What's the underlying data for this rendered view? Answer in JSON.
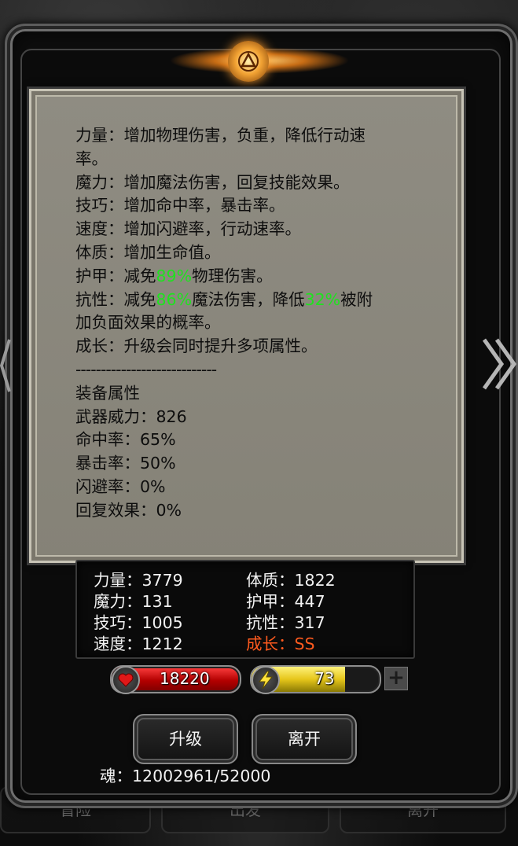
{
  "info_panel": {
    "lines": [
      {
        "id": "l1",
        "text": "力量：增加物理伤害，负重，降低行动速"
      },
      {
        "id": "l2",
        "text": "率。"
      },
      {
        "id": "l3",
        "text": "魔力：增加魔法伤害，回复技能效果。"
      },
      {
        "id": "l4",
        "text": "技巧：增加命中率，暴击率。"
      },
      {
        "id": "l5",
        "text": "速度：增加闪避率，行动速率。"
      },
      {
        "id": "l6",
        "text": "体质：增加生命值。"
      }
    ],
    "armor_line": {
      "prefix": "护甲：减免",
      "value": "89%",
      "suffix": "物理伤害。"
    },
    "resist_line": {
      "prefix": "抗性：减免",
      "value1": "86%",
      "middle": "魔法伤害，降低",
      "value2": "32%",
      "suffix": "被附"
    },
    "resist_line2": "加负面效果的概率。",
    "growth_line": "成长：升级会同时提升多项属性。",
    "divider": "----------------------------",
    "equip_title": "装备属性",
    "equip_lines": [
      "武器威力：826",
      "命中率：65%",
      "暴击率：50%",
      "闪避率：0%",
      "回复效果：0%"
    ]
  },
  "stats": {
    "strength": "力量：3779",
    "magic": "魔力：131",
    "skill": "技巧：1005",
    "speed": "速度：1212",
    "constitution": "体质：1822",
    "armor": "护甲：447",
    "resistance": "抗性：317",
    "growth": "成长：SS"
  },
  "hp": {
    "value": "18220",
    "icon": "heart-icon",
    "color": "#d01010"
  },
  "energy": {
    "value": "73",
    "fraction": 0.73,
    "icon": "lightning-icon",
    "color": "#e6c61a"
  },
  "plus_label": "+",
  "buttons": {
    "upgrade": "升级",
    "leave": "离开"
  },
  "soul": "魂：12002961/52000",
  "bottom_nav": [
    "冒险",
    "出发",
    "离开"
  ],
  "colors": {
    "accent_green": "#1fe21f",
    "growth_orange": "#ff5a1e"
  }
}
